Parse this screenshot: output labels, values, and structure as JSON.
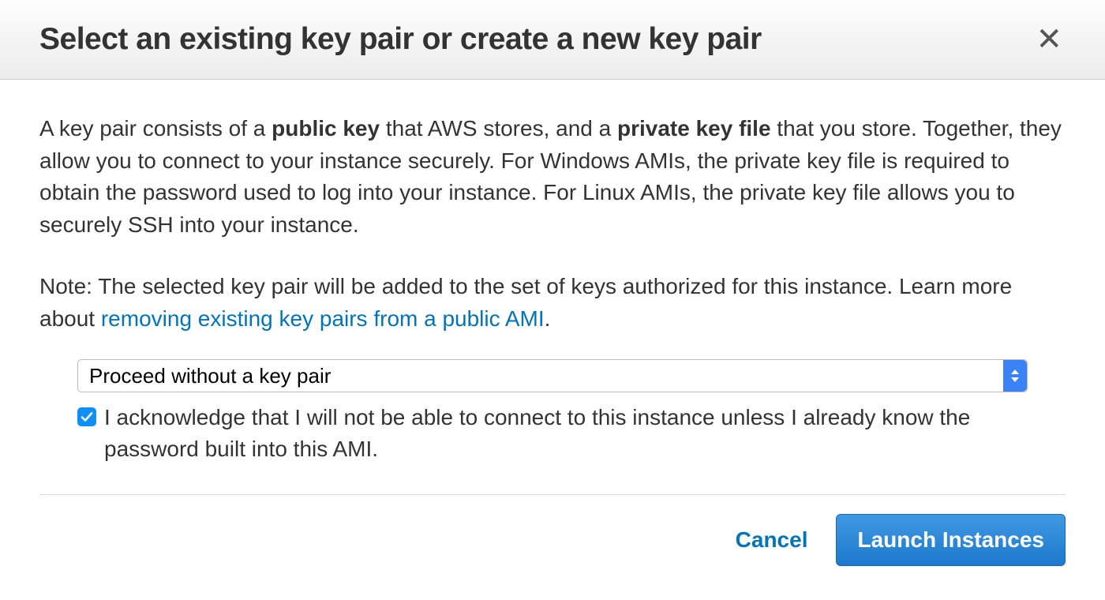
{
  "header": {
    "title": "Select an existing key pair or create a new key pair"
  },
  "body": {
    "desc_part1": "A key pair consists of a ",
    "desc_bold1": "public key",
    "desc_part2": " that AWS stores, and a ",
    "desc_bold2": "private key file",
    "desc_part3": " that you store. Together, they allow you to connect to your instance securely. For Windows AMIs, the private key file is required to obtain the password used to log into your instance. For Linux AMIs, the private key file allows you to securely SSH into your instance.",
    "note_part1": "Note: The selected key pair will be added to the set of keys authorized for this instance. Learn more about ",
    "note_link": "removing existing key pairs from a public AMI",
    "note_part2": "."
  },
  "form": {
    "select_value": "Proceed without a key pair",
    "checkbox_checked": true,
    "checkbox_label": "I acknowledge that I will not be able to connect to this instance unless I already know the password built into this AMI."
  },
  "footer": {
    "cancel": "Cancel",
    "launch": "Launch Instances"
  }
}
